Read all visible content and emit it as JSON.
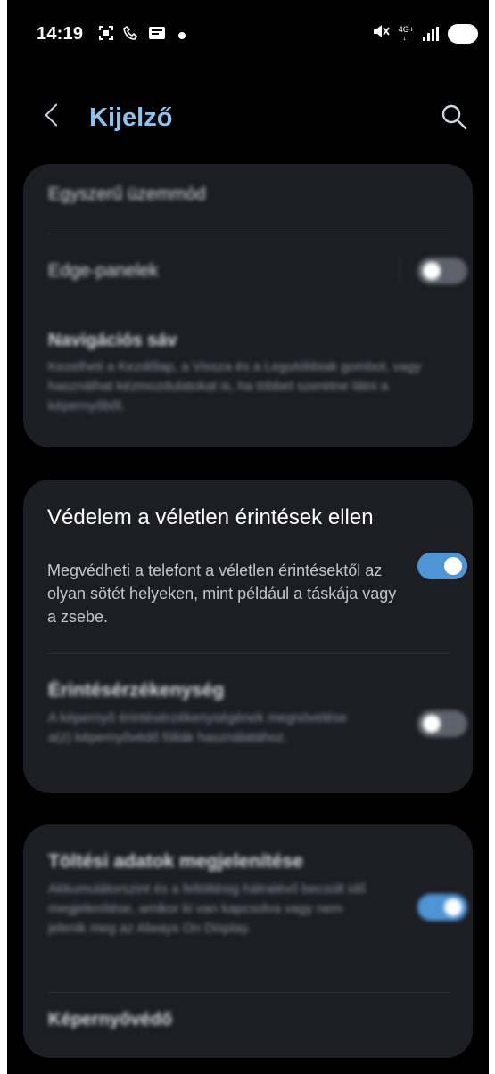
{
  "status_bar": {
    "time": "14:19",
    "network": "4G+",
    "icons": [
      "screenshot-icon",
      "call-icon",
      "mail-icon",
      "dot-icon",
      "mute-icon",
      "signal-icon",
      "battery-icon"
    ]
  },
  "header": {
    "title": "Kijelző",
    "back_icon": "chevron-left-icon",
    "search_icon": "search-icon"
  },
  "groups": [
    {
      "items": [
        {
          "title": "Egyszerű üzemmód"
        },
        {
          "title": "Edge-panelek",
          "toggle": "off"
        },
        {
          "title": "Navigációs sáv",
          "description": "Kezelheti a Kezdőlap, a Vissza és a Legutóbbiak gombot, vagy használhat kézmozdulatokat is, ha többet szeretne látni a képernyőből."
        }
      ]
    },
    {
      "items": [
        {
          "title": "Védelem a véletlen érintések ellen",
          "description": "Megvédheti a telefont a véletlen érintésektől az olyan sötét helyeken, mint például a táskája vagy a zsebe.",
          "toggle": "on"
        },
        {
          "title": "Érintésérzékenység",
          "description": "A képernyő érintésérzékenységének megnövelése a(z) képernyővédő fóliák használatához.",
          "toggle": "off"
        }
      ]
    },
    {
      "items": [
        {
          "title": "Töltési adatok megjelenítése",
          "description": "Akkumulátorszint és a feltöltésig hátralévő becsült idő megjelenítése, amikor ki van kapcsolva vagy nem jelenik meg az Always On Display.",
          "toggle": "on"
        },
        {
          "title": "Képernyővédő"
        }
      ]
    }
  ],
  "colors": {
    "accent": "#8cc4ef",
    "toggle_on": "#4f95d6",
    "toggle_off": "#5d626c",
    "card": "#1c1e24"
  }
}
